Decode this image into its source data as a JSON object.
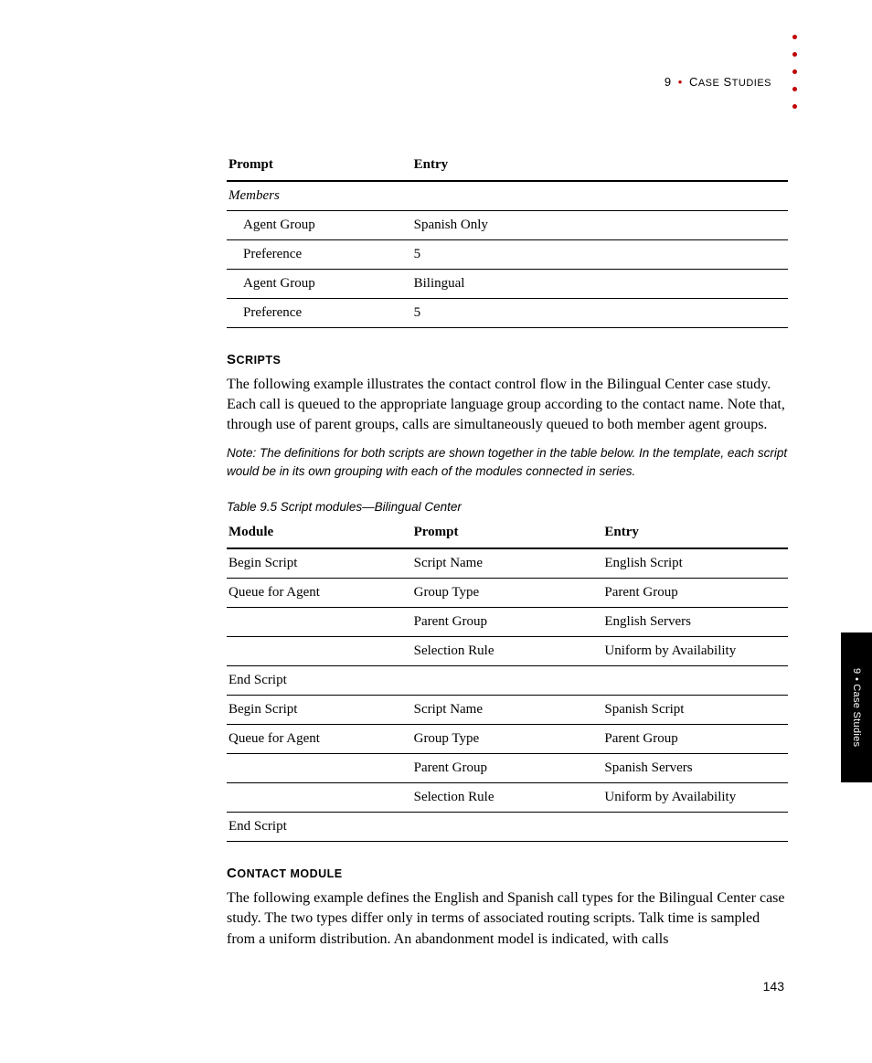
{
  "header": {
    "chapter_num": "9",
    "chapter_title": "CASE STUDIES"
  },
  "side_tab": {
    "chapter_num": "9",
    "chapter_title": "Case Studies"
  },
  "page_number": "143",
  "table1": {
    "headers": {
      "col1": "Prompt",
      "col2": "Entry"
    },
    "section_label": "Members",
    "rows": [
      {
        "prompt": "Agent Group",
        "entry": "Spanish Only"
      },
      {
        "prompt": "Preference",
        "entry": "5"
      },
      {
        "prompt": "Agent Group",
        "entry": "Bilingual"
      },
      {
        "prompt": "Preference",
        "entry": "5"
      }
    ]
  },
  "scripts_section": {
    "heading_first": "S",
    "heading_rest": "CRIPTS",
    "body": "The following example illustrates the contact control flow in the Bilingual Center case study. Each call is queued to the appropriate language group according to the contact name. Note that, through use of parent groups, calls are simultaneously queued to both member agent groups.",
    "note": "Note: The definitions for both scripts are shown together in the table below. In the template, each script would be in its own grouping with each of the modules connected in series."
  },
  "table2": {
    "caption": "Table 9.5 Script modules—Bilingual Center",
    "headers": {
      "col1": "Module",
      "col2": "Prompt",
      "col3": "Entry"
    },
    "rows": [
      {
        "module": "Begin Script",
        "prompt": "Script Name",
        "entry": "English Script"
      },
      {
        "module": "Queue for Agent",
        "prompt": "Group Type",
        "entry": "Parent Group"
      },
      {
        "module": "",
        "prompt": "Parent Group",
        "entry": "English Servers"
      },
      {
        "module": "",
        "prompt": "Selection Rule",
        "entry": "Uniform by Availability"
      },
      {
        "module": "End Script",
        "prompt": "",
        "entry": ""
      },
      {
        "module": "Begin Script",
        "prompt": "Script Name",
        "entry": "Spanish Script"
      },
      {
        "module": "Queue for Agent",
        "prompt": "Group Type",
        "entry": "Parent Group"
      },
      {
        "module": "",
        "prompt": "Parent Group",
        "entry": "Spanish Servers"
      },
      {
        "module": "",
        "prompt": "Selection Rule",
        "entry": "Uniform by Availability"
      },
      {
        "module": "End Script",
        "prompt": "",
        "entry": ""
      }
    ]
  },
  "contact_section": {
    "heading_first": "C",
    "heading_rest": "ONTACT MODULE",
    "body": "The following example defines the English and Spanish call types for the Bilingual Center case study. The two types differ only in terms of associated routing scripts. Talk time is sampled from a uniform distribution. An abandonment model is indicated, with calls"
  }
}
